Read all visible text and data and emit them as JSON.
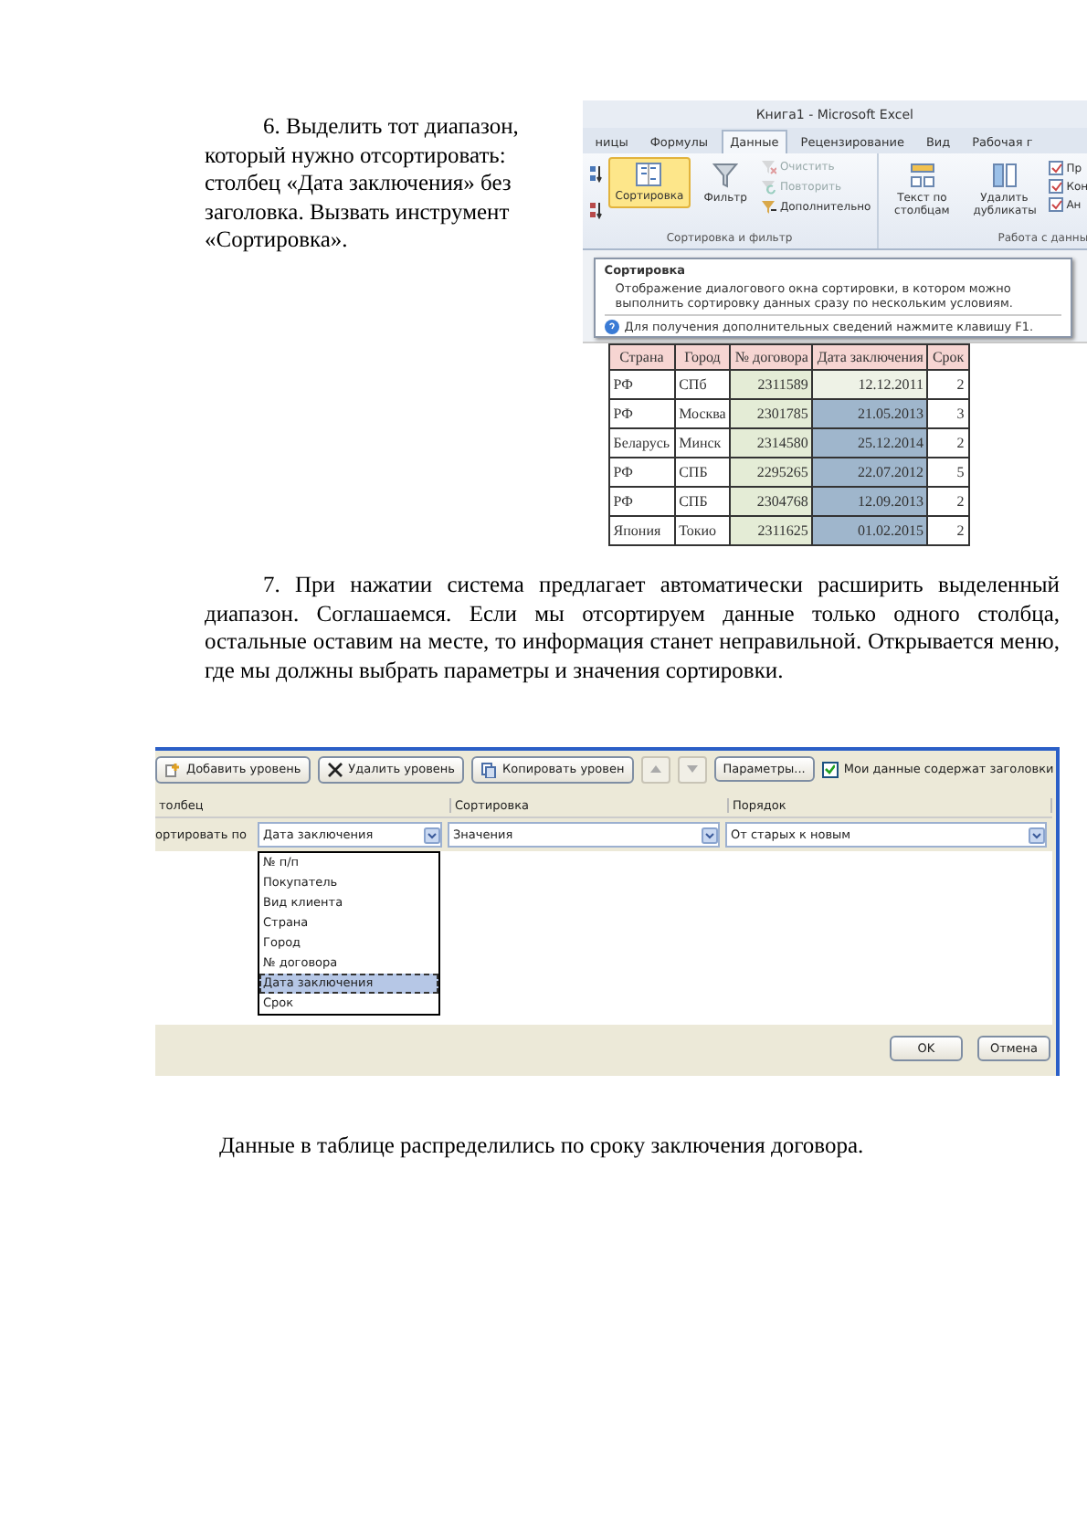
{
  "step6": {
    "text": "6. Выделить тот диапазон, который нужно отсортировать: столбец «Дата заключения» без заголовка. Вызвать инструмент «Сортировка»."
  },
  "excel": {
    "title": "Книга1 - Microsoft Excel",
    "tabs": [
      {
        "label": "ницы",
        "selected": false
      },
      {
        "label": "Формулы",
        "selected": false
      },
      {
        "label": "Данные",
        "selected": true
      },
      {
        "label": "Рецензирование",
        "selected": false
      },
      {
        "label": "Вид",
        "selected": false
      },
      {
        "label": "Рабочая г",
        "selected": false
      }
    ],
    "sort_button": {
      "label": "Сортировка",
      "selected": true
    },
    "filter_button": {
      "label": "Фильтр"
    },
    "filter_commands": [
      {
        "label": "Очистить",
        "disabled": true
      },
      {
        "label": "Повторить",
        "disabled": true
      },
      {
        "label": "Дополнительно",
        "disabled": false
      }
    ],
    "group_label": "Сортировка и фильтр",
    "tools": [
      {
        "label": "Текст по столбцам"
      },
      {
        "label": "Удалить дубликаты"
      }
    ],
    "small_tools": [
      {
        "label": "Пр"
      },
      {
        "label": "Кон"
      },
      {
        "label": "Ан"
      }
    ],
    "tools_group_label": "Работа с данны",
    "tooltip": {
      "title": "Сортировка",
      "text": "Отображение диалогового окна сортировки, в котором можно выполнить сортировку данных сразу по нескольким условиям.",
      "help": "Для получения дополнительных сведений нажмите клавишу F1."
    },
    "table": {
      "columns": [
        "Страна",
        "Город",
        "№ договора",
        "Дата заключения",
        "Срок"
      ],
      "rows": [
        {
          "cells": [
            "РФ",
            "СПб",
            "2311589",
            "12.12.2011",
            "2"
          ],
          "selected": false
        },
        {
          "cells": [
            "РФ",
            "Москва",
            "2301785",
            "21.05.2013",
            "3"
          ],
          "selected": true
        },
        {
          "cells": [
            "Беларусь",
            "Минск",
            "2314580",
            "25.12.2014",
            "2"
          ],
          "selected": true
        },
        {
          "cells": [
            "РФ",
            "СПБ",
            "2295265",
            "22.07.2012",
            "5"
          ],
          "selected": true
        },
        {
          "cells": [
            "РФ",
            "СПБ",
            "2304768",
            "12.09.2013",
            "2"
          ],
          "selected": true
        },
        {
          "cells": [
            "Япония",
            "Токио",
            "2311625",
            "01.02.2015",
            "2"
          ],
          "selected": true
        }
      ]
    }
  },
  "step7": {
    "text": "7. При нажатии система предлагает автоматически расширить выделенный диапазон. Соглашаемся. Если мы отсортируем данные только одного столбца, остальные оставим на месте, то информация станет неправильной. Открывается меню, где мы должны выбрать параметры и значения сортировки."
  },
  "sort_dialog": {
    "toolbar": [
      {
        "label": "Добавить уровень"
      },
      {
        "label": "Удалить уровень"
      },
      {
        "label": "Копировать уровен"
      }
    ],
    "move_buttons": [
      {
        "disabled": true
      },
      {
        "disabled": true
      }
    ],
    "options_button": "Параметры...",
    "headers_checkbox": {
      "label": "Мои данные содержат заголовки",
      "checked": true
    },
    "columns": [
      "толбец",
      "Сортировка",
      "Порядок"
    ],
    "level": {
      "label": "ортировать по",
      "column": "Дата заключения",
      "sort_on": "Значения",
      "order": "От старых к новым"
    },
    "dropdown": [
      {
        "label": "№ п/п",
        "selected": false
      },
      {
        "label": "Покупатель",
        "selected": false
      },
      {
        "label": "Вид клиента",
        "selected": false
      },
      {
        "label": "Страна",
        "selected": false
      },
      {
        "label": "Город",
        "selected": false
      },
      {
        "label": "№ договора",
        "selected": false
      },
      {
        "label": "Дата заключения",
        "selected": true
      },
      {
        "label": "Срок",
        "selected": false
      }
    ],
    "buttons": [
      "OK",
      "Отмена"
    ]
  },
  "result": {
    "text": "Данные в таблице распределились по сроку заключения договора."
  }
}
